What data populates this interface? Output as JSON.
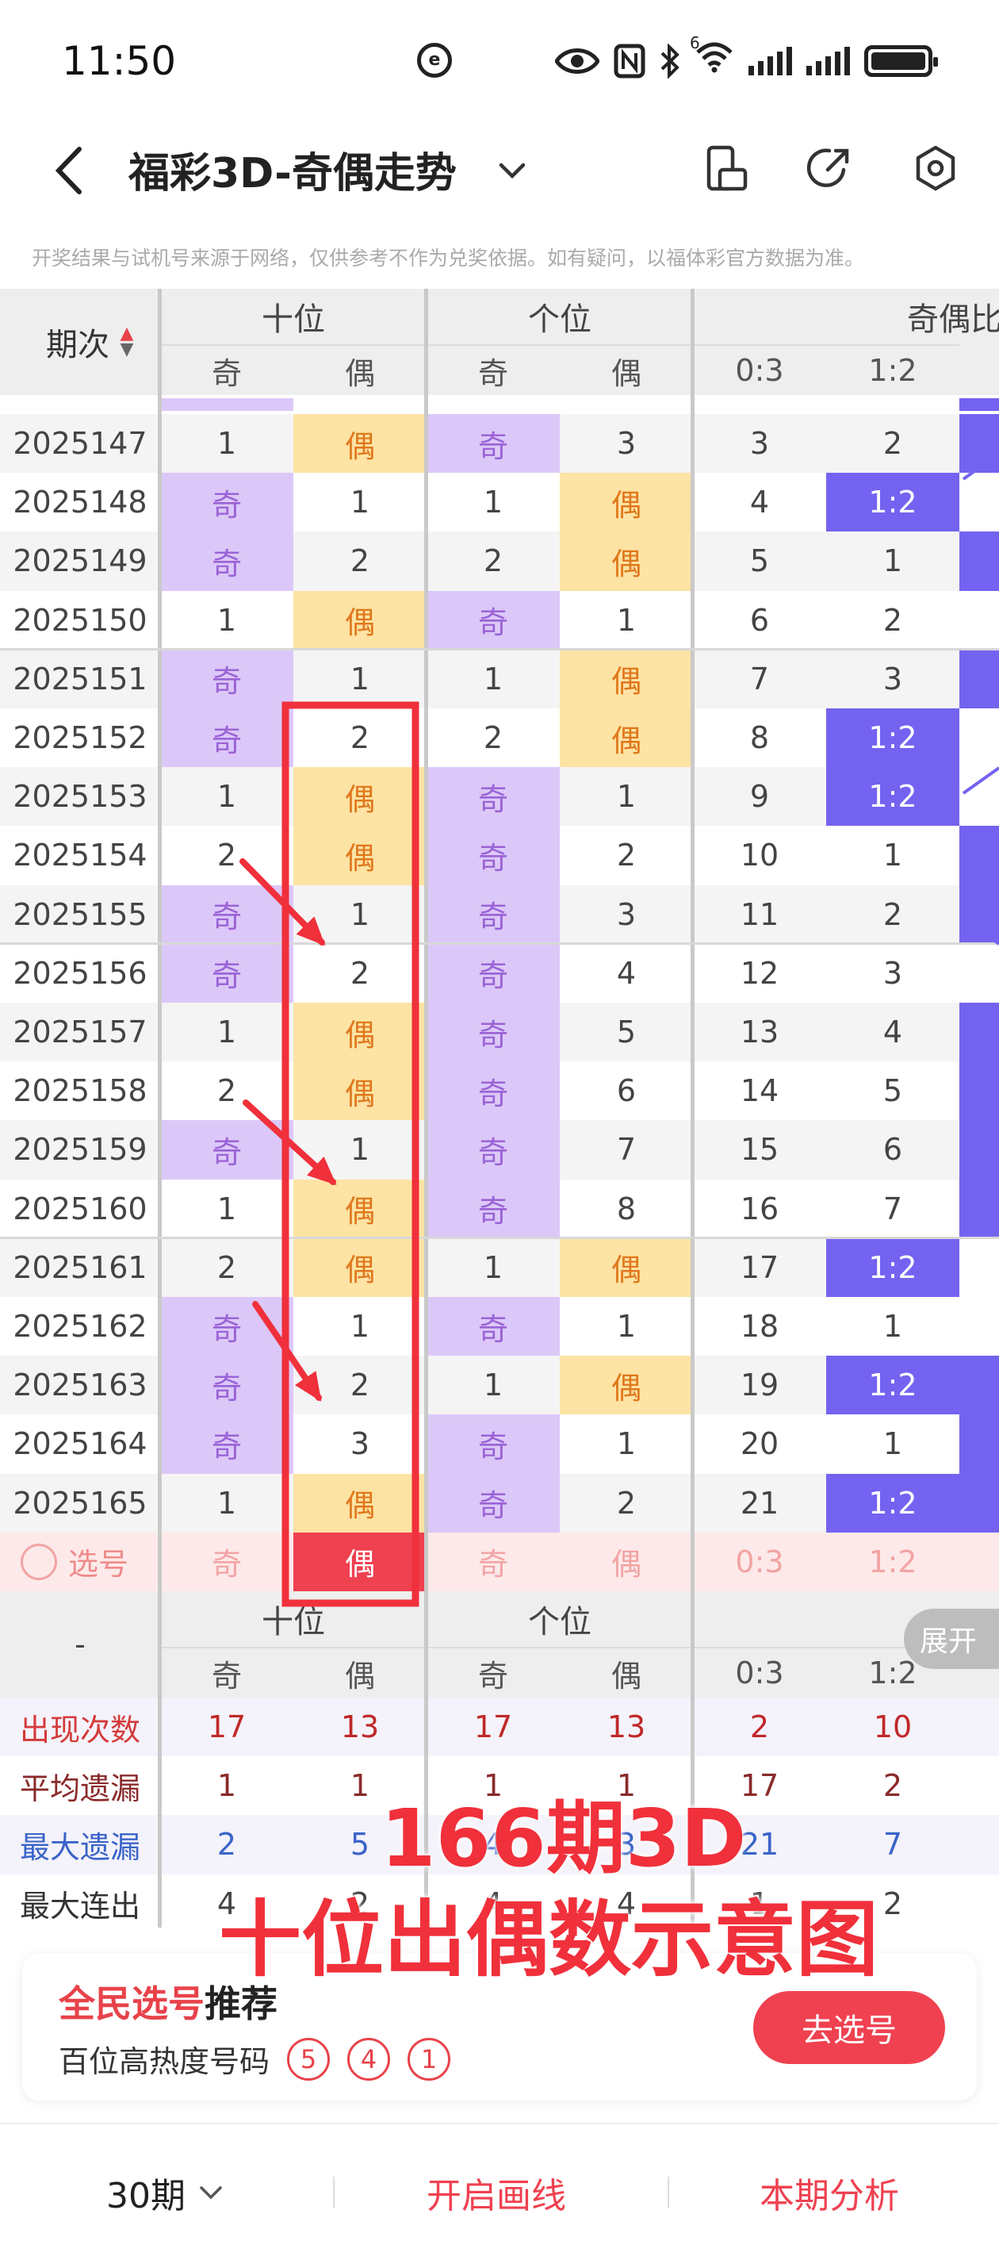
{
  "status_bar": {
    "time": "11:50",
    "net_icon_text": "e",
    "signal_sup": "6",
    "icons": [
      "eye-icon",
      "nfc-icon",
      "bluetooth-icon",
      "wifi-icon",
      "signal-icon",
      "signal-icon",
      "battery-icon"
    ]
  },
  "header": {
    "title": "福彩3D-奇偶走势",
    "icons": [
      "back-icon",
      "chevron-down-icon",
      "phone-landscape-icon",
      "share-icon",
      "settings-icon"
    ]
  },
  "disclaimer": "开奖结果与试机号来源于网络，仅供参考不作为兑奖依据。如有疑问，以福体彩官方数据为准。",
  "table": {
    "header": {
      "period_label": "期次",
      "groups": [
        "十位",
        "个位",
        "奇偶比"
      ],
      "sub": [
        "奇",
        "偶",
        "奇",
        "偶",
        "0:3",
        "1:2"
      ]
    },
    "rows": [
      {
        "period": "2025147",
        "cells": [
          "1",
          "偶",
          "奇",
          "3",
          "3",
          "2"
        ]
      },
      {
        "period": "2025148",
        "cells": [
          "奇",
          "1",
          "1",
          "偶",
          "4",
          "1:2"
        ]
      },
      {
        "period": "2025149",
        "cells": [
          "奇",
          "2",
          "2",
          "偶",
          "5",
          "1"
        ]
      },
      {
        "period": "2025150",
        "cells": [
          "1",
          "偶",
          "奇",
          "1",
          "6",
          "2"
        ]
      },
      {
        "period": "2025151",
        "cells": [
          "奇",
          "1",
          "1",
          "偶",
          "7",
          "3"
        ]
      },
      {
        "period": "2025152",
        "cells": [
          "奇",
          "2",
          "2",
          "偶",
          "8",
          "1:2"
        ]
      },
      {
        "period": "2025153",
        "cells": [
          "1",
          "偶",
          "奇",
          "1",
          "9",
          "1:2"
        ]
      },
      {
        "period": "2025154",
        "cells": [
          "2",
          "偶",
          "奇",
          "2",
          "10",
          "1"
        ]
      },
      {
        "period": "2025155",
        "cells": [
          "奇",
          "1",
          "奇",
          "3",
          "11",
          "2"
        ]
      },
      {
        "period": "2025156",
        "cells": [
          "奇",
          "2",
          "奇",
          "4",
          "12",
          "3"
        ]
      },
      {
        "period": "2025157",
        "cells": [
          "1",
          "偶",
          "奇",
          "5",
          "13",
          "4"
        ]
      },
      {
        "period": "2025158",
        "cells": [
          "2",
          "偶",
          "奇",
          "6",
          "14",
          "5"
        ]
      },
      {
        "period": "2025159",
        "cells": [
          "奇",
          "1",
          "奇",
          "7",
          "15",
          "6"
        ]
      },
      {
        "period": "2025160",
        "cells": [
          "1",
          "偶",
          "奇",
          "8",
          "16",
          "7"
        ]
      },
      {
        "period": "2025161",
        "cells": [
          "2",
          "偶",
          "1",
          "偶",
          "17",
          "1:2"
        ]
      },
      {
        "period": "2025162",
        "cells": [
          "奇",
          "1",
          "奇",
          "1",
          "18",
          "1"
        ]
      },
      {
        "period": "2025163",
        "cells": [
          "奇",
          "2",
          "1",
          "偶",
          "19",
          "1:2"
        ]
      },
      {
        "period": "2025164",
        "cells": [
          "奇",
          "3",
          "奇",
          "1",
          "20",
          "1"
        ]
      },
      {
        "period": "2025165",
        "cells": [
          "1",
          "偶",
          "奇",
          "2",
          "21",
          "1:2"
        ]
      }
    ],
    "select_row": {
      "label": "选号",
      "cells": [
        "奇",
        "偶",
        "奇",
        "偶",
        "0:3",
        "1:2"
      ]
    },
    "stats_header": {
      "first": "-",
      "groups": [
        "十位",
        "个位",
        "奇偶比"
      ],
      "sub": [
        "奇",
        "偶",
        "奇",
        "偶",
        "0:3",
        "1:2"
      ]
    },
    "expand_label": "展开",
    "stats": [
      {
        "label": "出现次数",
        "values": [
          "17",
          "13",
          "17",
          "13",
          "2",
          "10"
        ]
      },
      {
        "label": "平均遗漏",
        "values": [
          "1",
          "1",
          "1",
          "1",
          "17",
          "2"
        ]
      },
      {
        "label": "最大遗漏",
        "values": [
          "2",
          "5",
          "4",
          "3",
          "21",
          "7"
        ]
      },
      {
        "label": "最大连出",
        "values": [
          "4",
          "2",
          "4",
          "4",
          "1",
          "2"
        ]
      }
    ]
  },
  "annotation": {
    "line1": "166期3D",
    "line2": "十位出偶数示意图"
  },
  "recommend": {
    "title_red": "全民选号",
    "title_black": "推荐",
    "subtitle": "百位高热度号码",
    "balls": [
      "5",
      "4",
      "1"
    ],
    "button": "去选号"
  },
  "footer": {
    "periods": "30期",
    "draw_line": "开启画线",
    "analysis": "本期分析"
  },
  "colors": {
    "odd_bg": "#dcc8f8",
    "even_bg": "#fde3a4",
    "odd_text": "#9a63d6",
    "even_text": "#e0781c",
    "ratio_bg": "#7463f0",
    "accent_red": "#ef4150",
    "annotation_red": "#f0303b"
  }
}
